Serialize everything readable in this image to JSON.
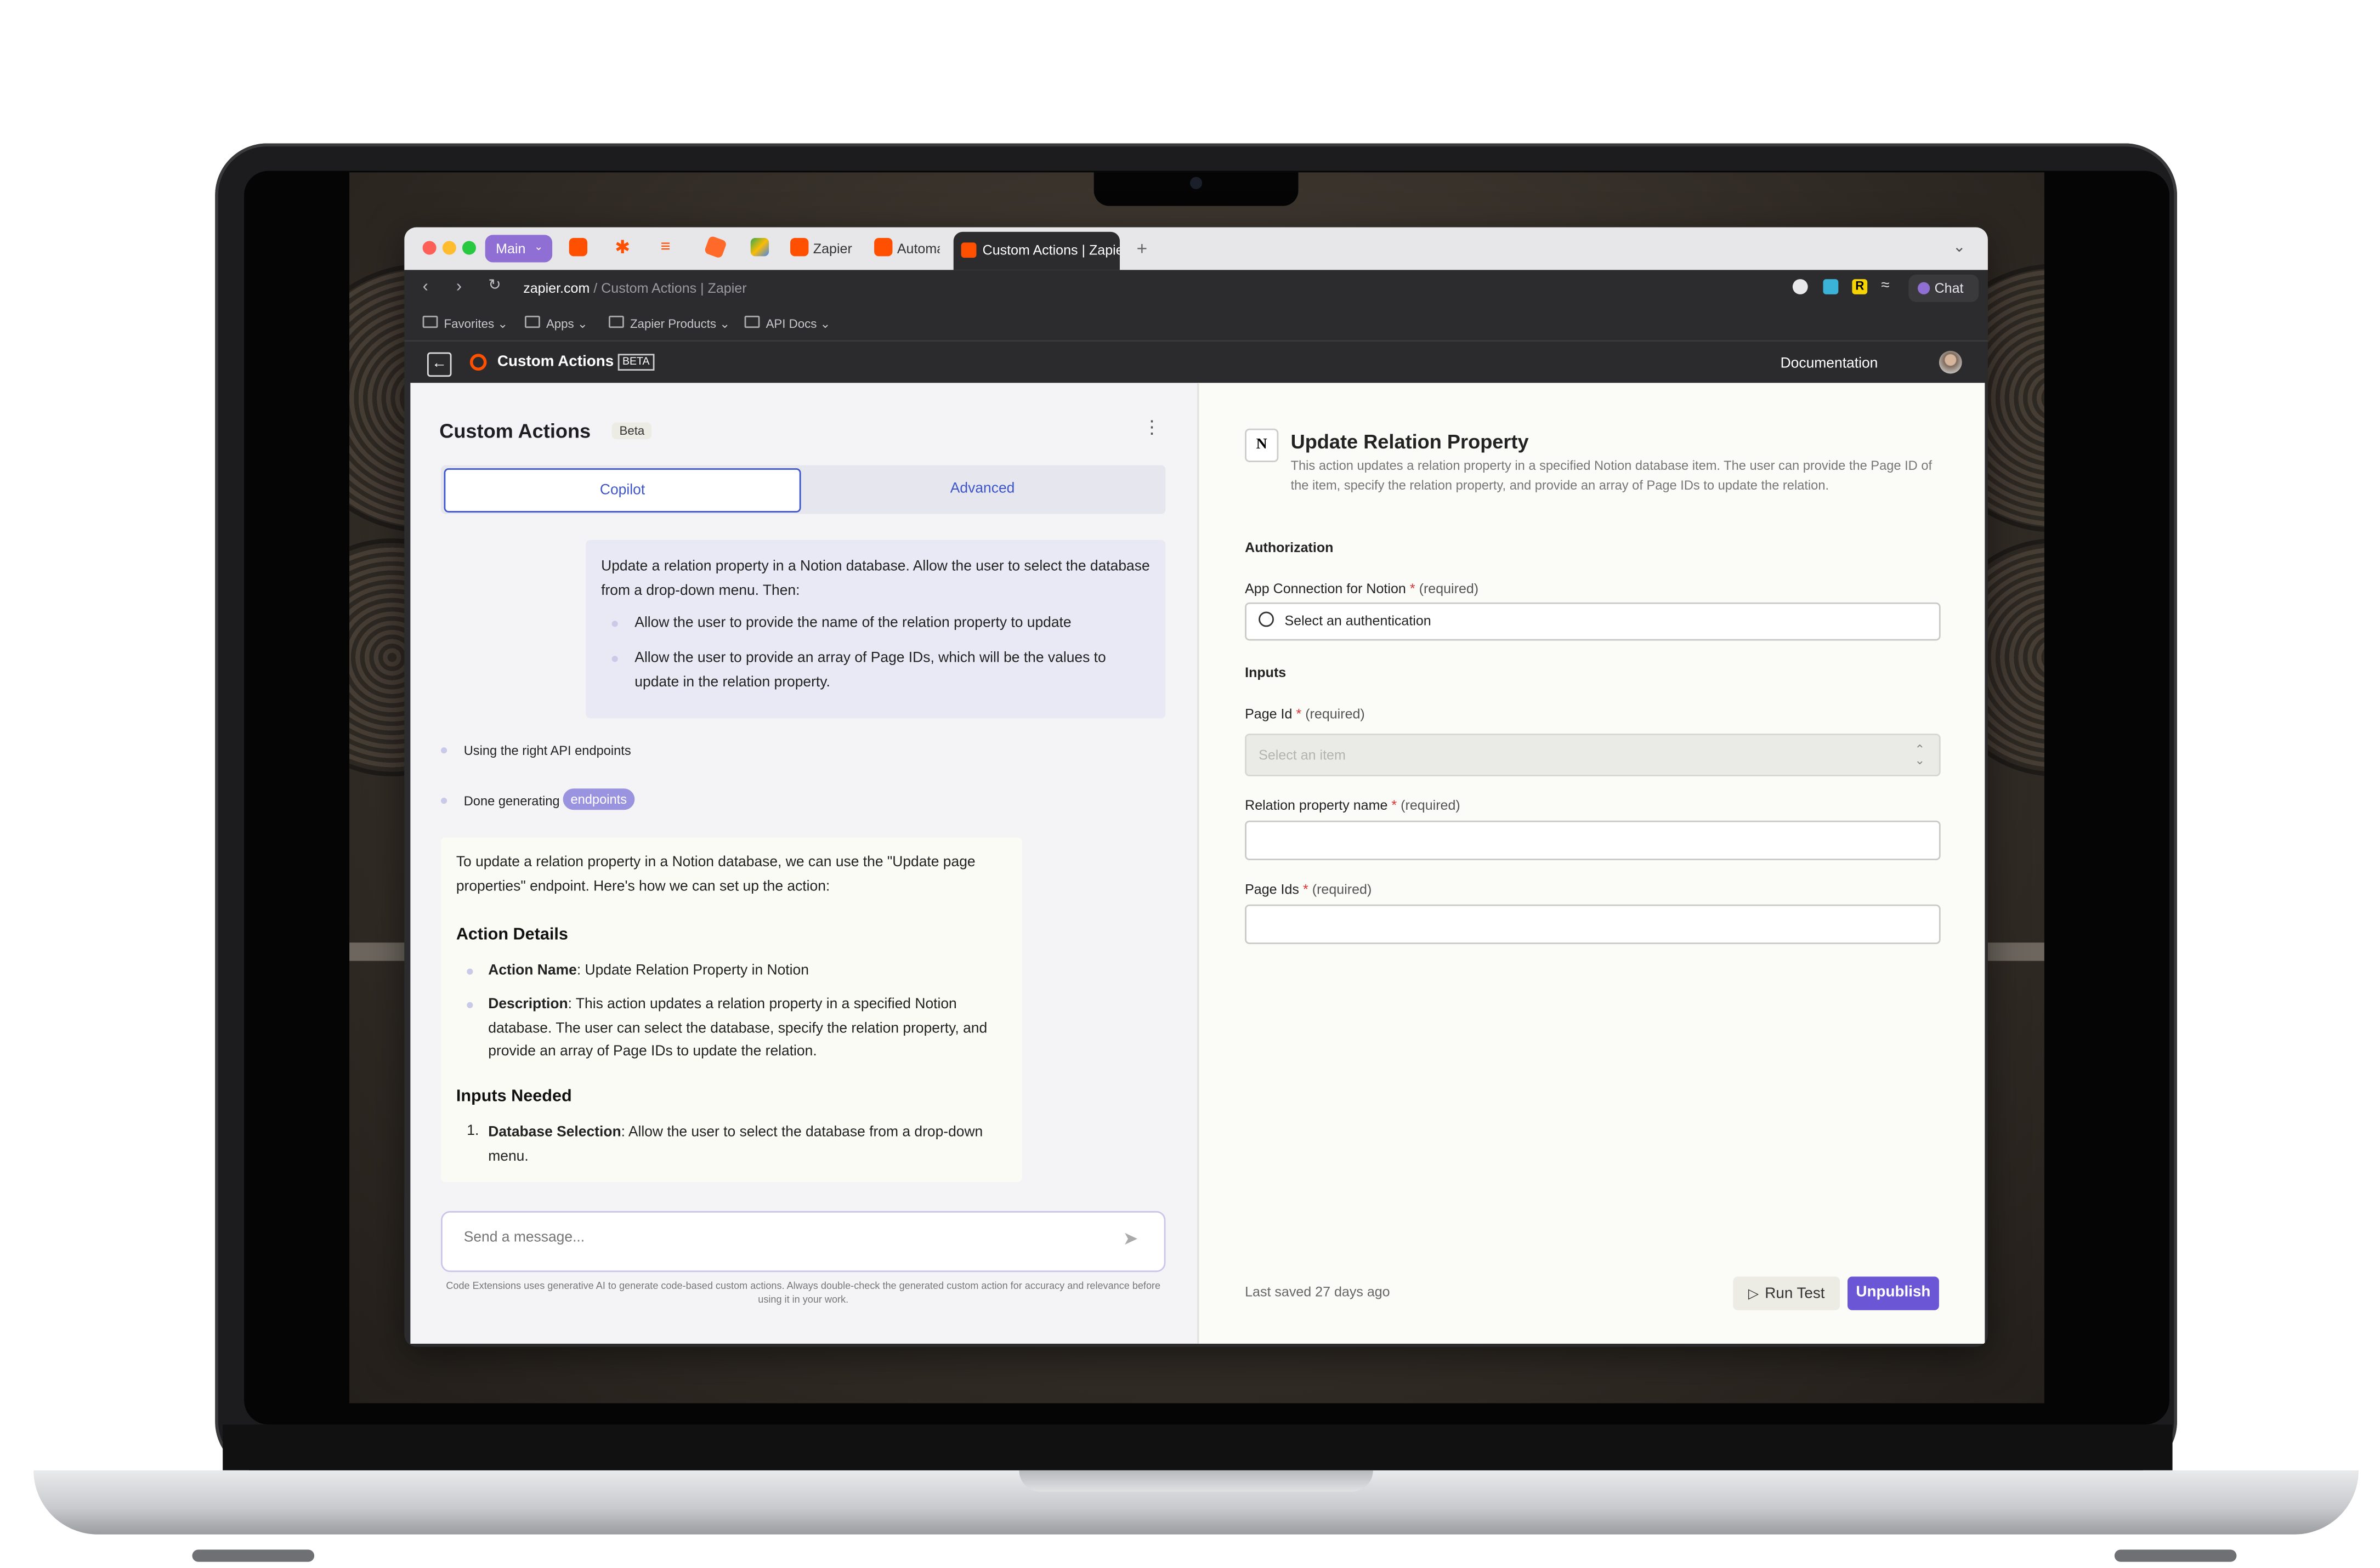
{
  "browser": {
    "profile": "Main",
    "tabs": [
      "Zapier C",
      "Automa"
    ],
    "active_tab": "Custom Actions | Zapie",
    "new_tab": "+",
    "url_domain": "zapier.com",
    "url_path": " / Custom Actions | Zapier",
    "chat_label": "Chat",
    "ext_badge": "R"
  },
  "bookmarks": [
    "Favorites",
    "Apps",
    "Zapier Products",
    "API Docs"
  ],
  "app_header": {
    "title": "Custom Actions",
    "badge": "BETA",
    "documentation": "Documentation"
  },
  "left": {
    "title": "Custom Actions",
    "beta": "Beta",
    "tabs": {
      "copilot": "Copilot",
      "advanced": "Advanced"
    },
    "user_message": {
      "intro": "Update a relation property in a Notion database. Allow the user to select the database from a drop-down menu. Then:",
      "items": [
        "Allow the user to provide the name of the relation property to update",
        "Allow the user to provide an array of Page IDs, which will be the values to update in the relation property."
      ]
    },
    "status": [
      {
        "text": "Using the right API endpoints",
        "pill": ""
      },
      {
        "text": "Done generating",
        "pill": "endpoints"
      }
    ],
    "response": {
      "intro": "To update a relation property in a Notion database, we can use the \"Update page properties\" endpoint. Here's how we can set up the action:",
      "h1": "Action Details",
      "details": [
        {
          "key": "Action Name",
          "value": ": Update Relation Property in Notion"
        },
        {
          "key": "Description",
          "value": ": This action updates a relation property in a specified Notion database. The user can select the database, specify the relation property, and provide an array of Page IDs to update the relation."
        }
      ],
      "h2": "Inputs Needed",
      "inputs": [
        {
          "num": "1.",
          "key": "Database Selection",
          "value": ": Allow the user to select the database from a drop-down menu."
        }
      ]
    },
    "composer_placeholder": "Send a message...",
    "disclaimer": "Code Extensions uses generative AI to generate code-based custom actions. Always double-check the generated custom action for accuracy and relevance before using it in your work."
  },
  "right": {
    "title": "Update Relation Property",
    "description": "This action updates a relation property in a specified Notion database item. The user can provide the Page ID of the item, specify the relation property, and provide an array of Page IDs to update the relation.",
    "authorization_heading": "Authorization",
    "app_connection_label": "App Connection for Notion",
    "auth_placeholder": "Select an authentication",
    "inputs_heading": "Inputs",
    "page_id_label": "Page Id",
    "page_id_placeholder": "Select an item",
    "relation_label": "Relation property name",
    "page_ids_label": "Page Ids",
    "required_marker": "*",
    "required_text": "(required)",
    "last_saved": "Last saved 27 days ago",
    "run_test": "Run Test",
    "unpublish": "Unpublish"
  },
  "colors": {
    "accent": "#6b57d6",
    "zapier_orange": "#ff4f00",
    "copilot_border": "#3d55c9",
    "pill": "#9a93e0"
  },
  "icons": [
    "back-arrow-icon",
    "zapier-logo-icon",
    "notion-logo-icon",
    "search-icon",
    "send-icon",
    "play-icon",
    "kebab-menu-icon",
    "chevron-updown-icon",
    "folder-icon",
    "reload-icon"
  ]
}
